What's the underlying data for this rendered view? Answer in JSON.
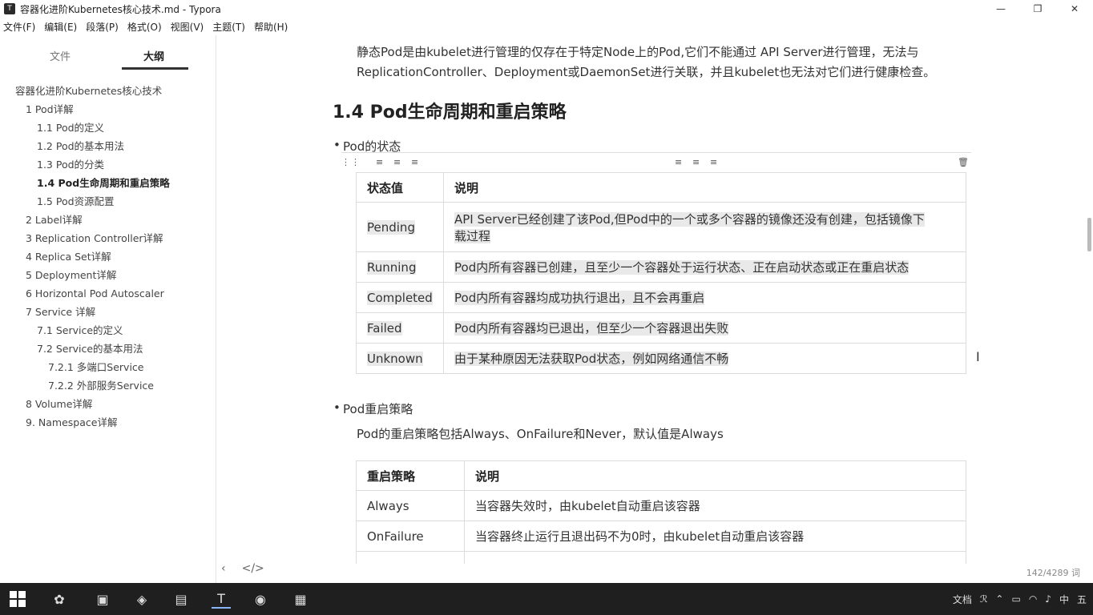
{
  "window": {
    "title": "容器化进阶Kubernetes核心技术.md - Typora",
    "minimize": "—",
    "maximize": "❐",
    "close": "✕"
  },
  "menu": [
    "文件(F)",
    "编辑(E)",
    "段落(P)",
    "格式(O)",
    "视图(V)",
    "主题(T)",
    "帮助(H)"
  ],
  "sidebar": {
    "tab_files": "文件",
    "tab_outline": "大纲",
    "outline": [
      {
        "label": "容器化进阶Kubernetes核心技术",
        "level": 0,
        "active": false
      },
      {
        "label": "1 Pod详解",
        "level": 1,
        "active": false
      },
      {
        "label": "1.1 Pod的定义",
        "level": 2,
        "active": false
      },
      {
        "label": "1.2 Pod的基本用法",
        "level": 2,
        "active": false
      },
      {
        "label": "1.3 Pod的分类",
        "level": 2,
        "active": false
      },
      {
        "label": "1.4 Pod生命周期和重启策略",
        "level": 2,
        "active": true
      },
      {
        "label": "1.5 Pod资源配置",
        "level": 2,
        "active": false
      },
      {
        "label": "2 Label详解",
        "level": 1,
        "active": false
      },
      {
        "label": "3 Replication Controller详解",
        "level": 1,
        "active": false
      },
      {
        "label": "4 Replica Set详解",
        "level": 1,
        "active": false
      },
      {
        "label": "5 Deployment详解",
        "level": 1,
        "active": false
      },
      {
        "label": "6 Horizontal Pod Autoscaler",
        "level": 1,
        "active": false
      },
      {
        "label": "7 Service 详解",
        "level": 1,
        "active": false
      },
      {
        "label": "7.1 Service的定义",
        "level": 2,
        "active": false
      },
      {
        "label": "7.2 Service的基本用法",
        "level": 2,
        "active": false
      },
      {
        "label": "7.2.1 多端口Service",
        "level": 3,
        "active": false
      },
      {
        "label": "7.2.2 外部服务Service",
        "level": 3,
        "active": false
      },
      {
        "label": "8 Volume详解",
        "level": 1,
        "active": false
      },
      {
        "label": "9. Namespace详解",
        "level": 1,
        "active": false
      }
    ]
  },
  "content": {
    "intro_line1": "静态Pod是由kubelet进行管理的仅存在于特定Node上的Pod,它们不能通过 API Server进行管理，无法与",
    "intro_line2": "ReplicationController、Deployment或DaemonSet进行关联，并且kubelet也无法对它们进行健康检查。",
    "heading": "1.4 Pod生命周期和重启策略",
    "bullet1": "Pod的状态",
    "table1": {
      "headers": [
        "状态值",
        "说明"
      ],
      "rows": [
        [
          "Pending",
          "API Server已经创建了该Pod,但Pod中的一个或多个容器的镜像还没有创建，包括镜像下",
          "载过程"
        ],
        [
          "Running",
          "Pod内所有容器已创建，且至少一个容器处于运行状态、正在启动状态或正在重启状态"
        ],
        [
          "Completed",
          "Pod内所有容器均成功执行退出，且不会再重启"
        ],
        [
          "Failed",
          "Pod内所有容器均已退出，但至少一个容器退出失败"
        ],
        [
          "Unknown",
          "由于某种原因无法获取Pod状态，例如网络通信不畅"
        ]
      ]
    },
    "bullet2": "Pod重启策略",
    "restart_para": "Pod的重启策略包括Always、OnFailure和Never，默认值是Always",
    "table2": {
      "headers": [
        "重启策略",
        "说明"
      ],
      "rows": [
        [
          "Always",
          "当容器失效时，由kubelet自动重启该容器"
        ],
        [
          "OnFailure",
          "当容器终止运行且退出码不为0时，由kubelet自动重启该容器"
        ]
      ]
    }
  },
  "statusbar": {
    "wordcount": "142/4289 词",
    "nav_left": "‹",
    "source_toggle": "</>"
  },
  "taskbar": {
    "tray_wendang": "文档",
    "ime": "中",
    "ime2": "五"
  }
}
